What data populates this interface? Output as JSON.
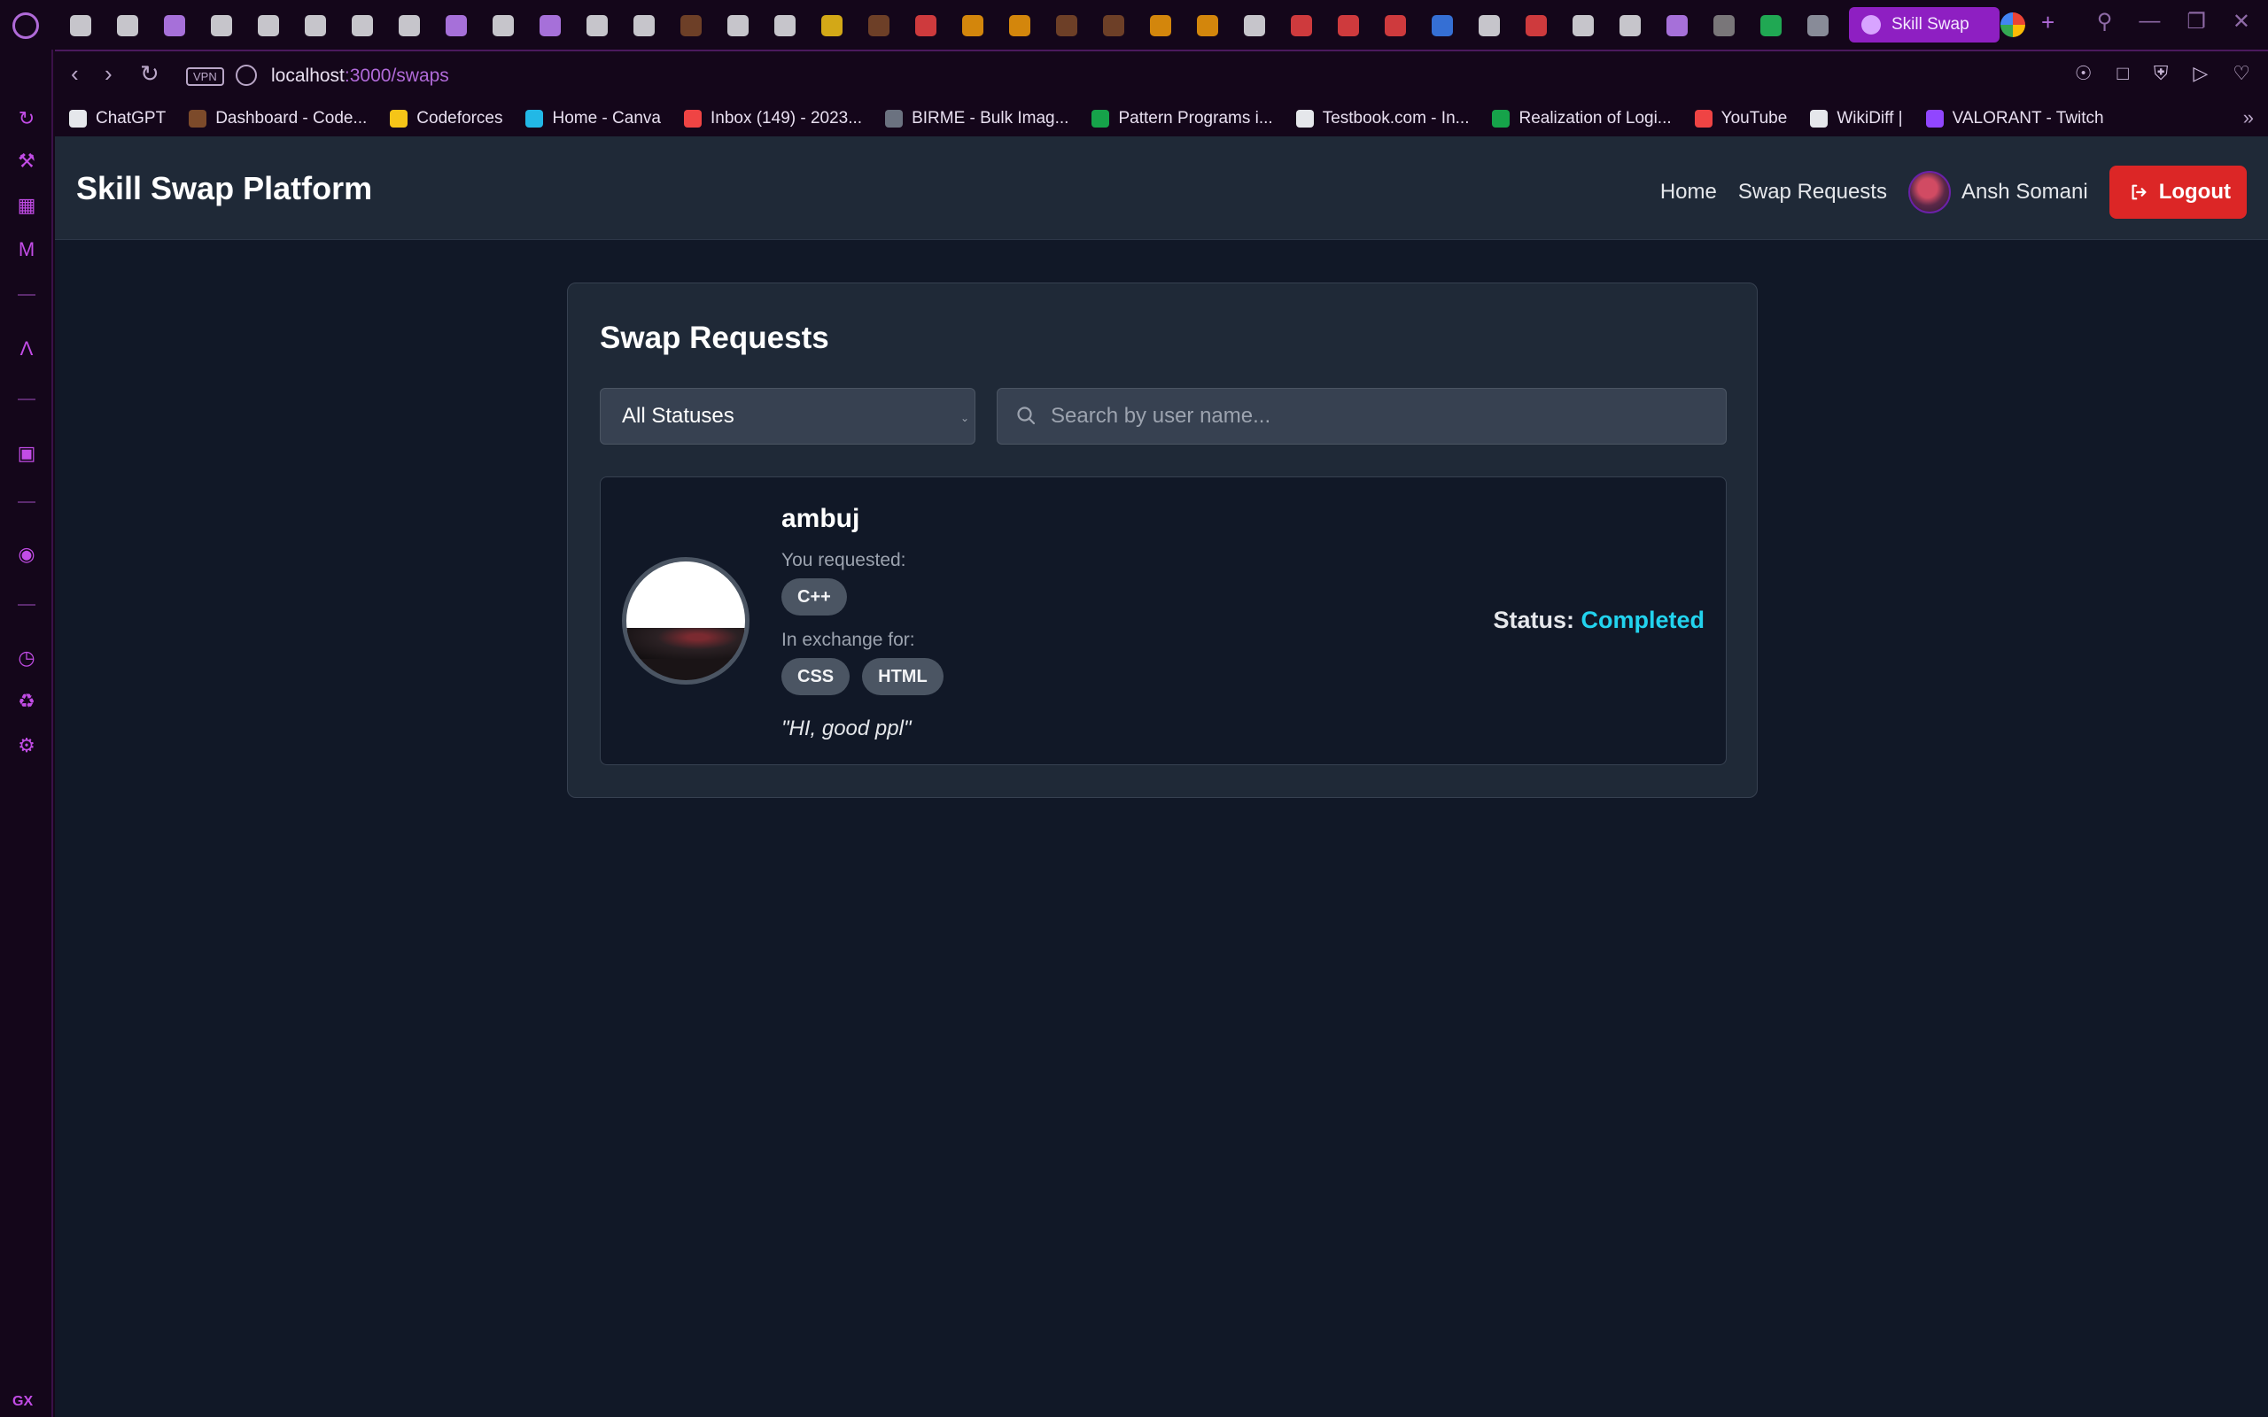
{
  "browser": {
    "active_tab_title": "Skill Swap",
    "vpn_label": "VPN",
    "url_host": "localhost",
    "url_path": ":3000/swaps",
    "tab_strip": [
      {
        "icon": "game-icon",
        "color": "#e5e7eb"
      },
      {
        "icon": "hackerrank-icon",
        "color": "#e5e7eb"
      },
      {
        "icon": "globe-icon",
        "color": "#c084fc"
      },
      {
        "icon": "document-icon",
        "color": "#e5e7eb"
      },
      {
        "icon": "document-icon",
        "color": "#e5e7eb"
      },
      {
        "icon": "document-icon",
        "color": "#e5e7eb"
      },
      {
        "icon": "document-icon",
        "color": "#e5e7eb"
      },
      {
        "icon": "document-icon",
        "color": "#e5e7eb"
      },
      {
        "icon": "globe-icon",
        "color": "#c084fc"
      },
      {
        "icon": "document-icon",
        "color": "#e5e7eb"
      },
      {
        "icon": "globe-icon",
        "color": "#c084fc"
      },
      {
        "icon": "document-icon",
        "color": "#e5e7eb"
      },
      {
        "icon": "document-icon",
        "color": "#e5e7eb"
      },
      {
        "icon": "codechef-icon",
        "color": "#7c4a2a"
      },
      {
        "icon": "document-icon",
        "color": "#e5e7eb"
      },
      {
        "icon": "document-icon",
        "color": "#e5e7eb"
      },
      {
        "icon": "codeforces-icon",
        "color": "#f5c518"
      },
      {
        "icon": "codechef-icon",
        "color": "#7c4a2a"
      },
      {
        "icon": "youtube-icon",
        "color": "#ef4444"
      },
      {
        "icon": "leetcode-icon",
        "color": "#f59e0b"
      },
      {
        "icon": "leetcode-icon",
        "color": "#f59e0b"
      },
      {
        "icon": "codechef-icon",
        "color": "#7c4a2a"
      },
      {
        "icon": "codechef-icon",
        "color": "#7c4a2a"
      },
      {
        "icon": "leetcode-icon",
        "color": "#f59e0b"
      },
      {
        "icon": "leetcode-icon",
        "color": "#f59e0b"
      },
      {
        "icon": "chatgpt-icon",
        "color": "#e5e7eb"
      },
      {
        "icon": "youtube-icon",
        "color": "#ef4444"
      },
      {
        "icon": "gfg-icon",
        "color": "#ef4444"
      },
      {
        "icon": "gmail-icon",
        "color": "#ef4444"
      },
      {
        "icon": "vscode-icon",
        "color": "#3b82f6"
      },
      {
        "icon": "github-icon",
        "color": "#e5e7eb"
      },
      {
        "icon": "youtube-icon",
        "color": "#ef4444"
      },
      {
        "icon": "chatgpt-icon",
        "color": "#e5e7eb"
      },
      {
        "icon": "chatgpt-icon",
        "color": "#e5e7eb"
      },
      {
        "icon": "globe-icon",
        "color": "#c084fc"
      },
      {
        "icon": "opera-icon",
        "color": "#8b8b8b"
      },
      {
        "icon": "meet-icon",
        "color": "#22c55e"
      },
      {
        "icon": "screen-icon",
        "color": "#9ca3af"
      }
    ]
  },
  "bookmarks": [
    {
      "label": "ChatGPT",
      "icon": "chatgpt-icon",
      "color": "#e5e7eb"
    },
    {
      "label": "Dashboard - Code...",
      "icon": "codechef-icon",
      "color": "#7c4a2a"
    },
    {
      "label": "Codeforces",
      "icon": "codeforces-icon",
      "color": "#f5c518"
    },
    {
      "label": "Home - Canva",
      "icon": "canva-icon",
      "color": "#22b8e6"
    },
    {
      "label": "Inbox (149) - 2023...",
      "icon": "gmail-icon",
      "color": "#ef4444"
    },
    {
      "label": "BIRME - Bulk Imag...",
      "icon": "birme-icon",
      "color": "#6b7280"
    },
    {
      "label": "Pattern Programs i...",
      "icon": "gfg-icon",
      "color": "#16a34a"
    },
    {
      "label": "Testbook.com - In...",
      "icon": "testbook-icon",
      "color": "#e5e7eb"
    },
    {
      "label": "Realization of Logi...",
      "icon": "gfg-icon",
      "color": "#16a34a"
    },
    {
      "label": "YouTube",
      "icon": "youtube-icon",
      "color": "#ef4444"
    },
    {
      "label": "WikiDiff |",
      "icon": "wikidiff-icon",
      "color": "#e5e7eb"
    },
    {
      "label": "VALORANT - Twitch",
      "icon": "twitch-icon",
      "color": "#9146ff"
    }
  ],
  "app": {
    "brand": "Skill Swap Platform",
    "nav": {
      "home": "Home",
      "swap_requests": "Swap Requests",
      "user_name": "Ansh Somani",
      "logout": "Logout"
    }
  },
  "swaps": {
    "title": "Swap Requests",
    "status_filter": "All Statuses",
    "search_placeholder": "Search by user name...",
    "requests": [
      {
        "user": "ambuj",
        "requested_label": "You requested:",
        "requested_skills": [
          "C++"
        ],
        "exchange_label": "In exchange for:",
        "offered_skills": [
          "CSS",
          "HTML"
        ],
        "message": "\"HI, good ppl\"",
        "status_label": "Status:",
        "status": "Completed",
        "status_color": "#22d3ee"
      }
    ]
  },
  "colors": {
    "browser_accent": "#b06ad8",
    "logout": "#dc2626",
    "page_bg": "#111827",
    "panel_bg": "#1f2937"
  }
}
